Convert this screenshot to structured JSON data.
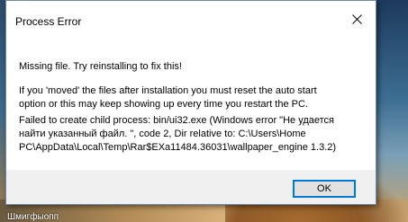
{
  "dialog": {
    "title": "Process Error",
    "close_icon": "close-icon",
    "message_line1": "Missing file. Try reinstalling to fix this!",
    "message_line2a": "If you 'moved' the files after installation you must reset the auto start",
    "message_line2b": "option or this may keep showing up every time you restart the PC.",
    "message_line3a": "Failed to create child process: bin/ui32.exe (Windows error \"Не удается",
    "message_line3b": "найти указанный файл. \", code 2, Dir relative to: C:\\Users\\Home",
    "message_line3c": "PC\\AppData\\Local\\Temp\\Rar$EXa11484.36031\\wallpaper_engine 1.3.2)",
    "ok_label": "OK"
  },
  "desktop": {
    "label": "Шмигфыопп"
  },
  "colors": {
    "accent": "#0078d7",
    "dialog_bg": "#f0f0f0",
    "content_bg": "#ffffff"
  }
}
